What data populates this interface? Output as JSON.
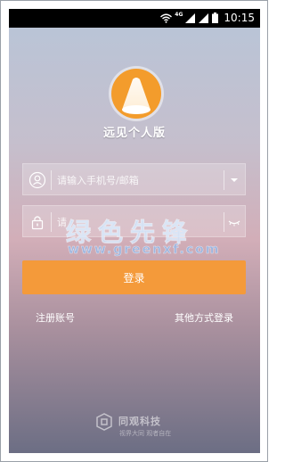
{
  "status_bar": {
    "network": "4G",
    "time": "10:15"
  },
  "app": {
    "title": "远见个人版"
  },
  "form": {
    "phone_placeholder": "请输入手机号/邮箱",
    "password_placeholder": "请"
  },
  "watermark": {
    "text": "绿色先锋",
    "url": "www.greenxf.com"
  },
  "actions": {
    "login_label": "登录",
    "register_label": "注册账号",
    "other_login_label": "其他方式登录"
  },
  "footer": {
    "brand_name": "同观科技",
    "slogan": "视界大同 观者自在"
  },
  "colors": {
    "accent": "#f49a3a",
    "logo": "#f39c2c"
  }
}
